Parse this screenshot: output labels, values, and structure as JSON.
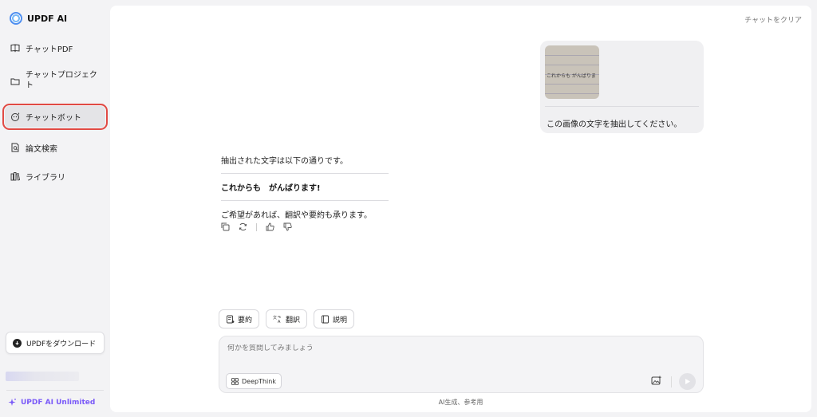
{
  "sidebar": {
    "brand": "UPDF AI",
    "items": [
      {
        "label": "チャットPDF"
      },
      {
        "label": "チャットプロジェクト"
      },
      {
        "label": "チャットボット"
      },
      {
        "label": "論文検索"
      },
      {
        "label": "ライブラリ"
      }
    ],
    "download_label": "UPDFをダウンロード",
    "unlimited_label": "UPDF AI Unlimited"
  },
  "header": {
    "clear_label": "チャットをクリア"
  },
  "conversation": {
    "user_image_text": "これからも がんばりま",
    "user_message": "この画像の文字を抽出してください。",
    "bot_intro": "抽出された文字は以下の通りです。",
    "bot_extracted": "これからも　がんばります!",
    "bot_followup": "ご希望があれば、翻訳や要約も承ります。"
  },
  "quick_actions": [
    {
      "label": "要約"
    },
    {
      "label": "翻訳"
    },
    {
      "label": "説明"
    }
  ],
  "composer": {
    "placeholder": "何かを質問してみましょう",
    "deepthink_label": "DeepThink"
  },
  "footnote": "AI生成、参考用",
  "colors": {
    "highlight_border": "#e14a44",
    "accent_purple": "#7a5af8",
    "arrow": "#e8453f"
  }
}
